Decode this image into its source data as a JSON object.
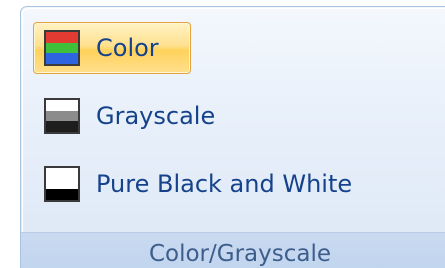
{
  "group": {
    "label": "Color/Grayscale",
    "buttons": [
      {
        "label": "Color",
        "icon": "color-mode-icon",
        "selected": true,
        "swatch_colors": [
          "#e23b32",
          "#3fbf3a",
          "#2f64e0"
        ]
      },
      {
        "label": "Grayscale",
        "icon": "grayscale-mode-icon",
        "selected": false,
        "swatch_colors": [
          "#ffffff",
          "#8c8c8c",
          "#1e1e1e"
        ]
      },
      {
        "label": "Pure Black and White",
        "icon": "black-white-mode-icon",
        "selected": false,
        "swatch_colors": [
          "#ffffff",
          "#ffffff",
          "#000000"
        ]
      }
    ]
  },
  "colors": {
    "text": "#15428b",
    "selected_border": "#e3a33f",
    "group_label_text": "#3d5e8c"
  }
}
